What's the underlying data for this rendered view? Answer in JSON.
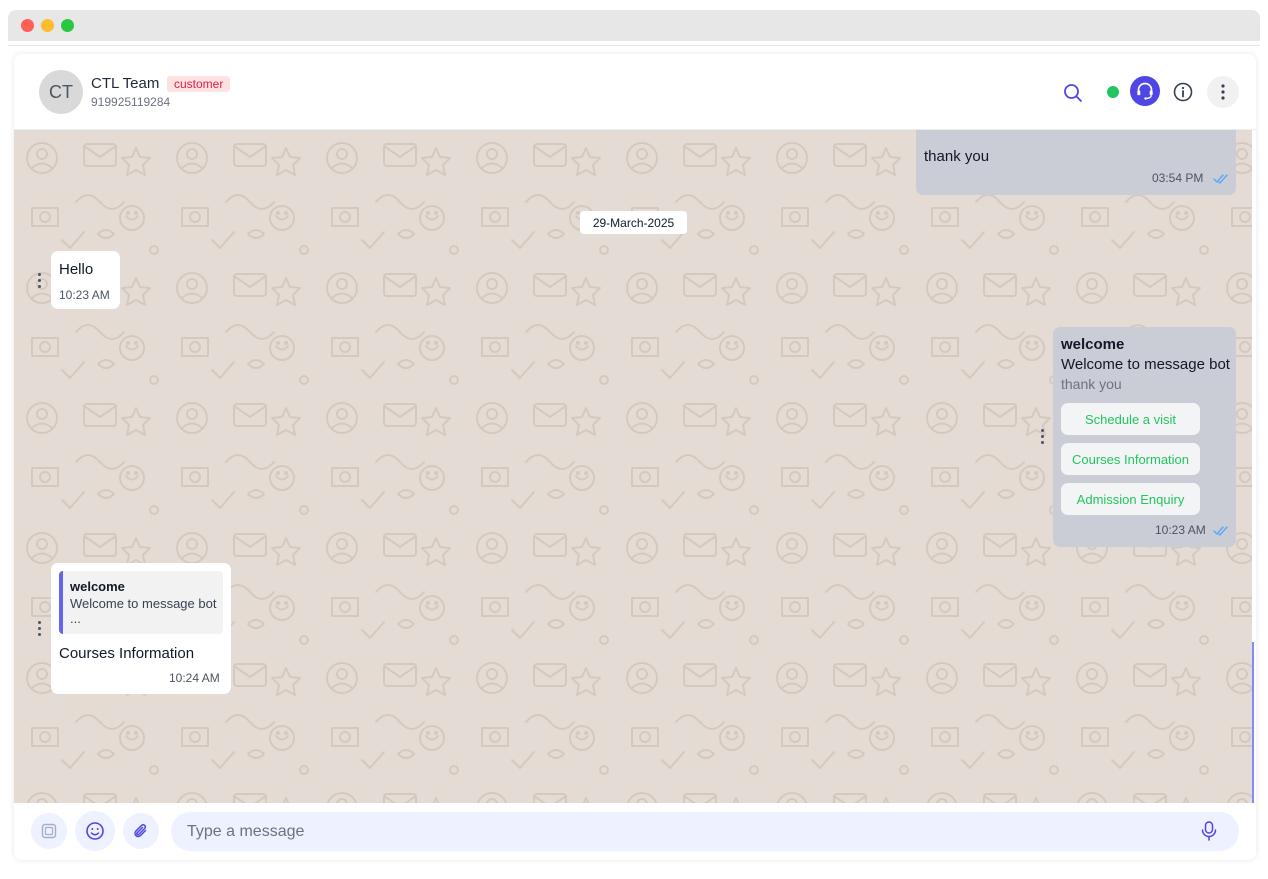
{
  "contact": {
    "initials": "CT",
    "name": "CTL Team",
    "tag": "customer",
    "phone": "919925119284"
  },
  "header_icons": [
    "search-icon",
    "online-status",
    "agent-support-icon",
    "info-icon",
    "more-vertical-icon"
  ],
  "colors": {
    "chat_background": "#e4dcd4",
    "outgoing_bubble": "#cacdd5",
    "incoming_bubble": "#ffffff",
    "online": "#22c55e",
    "accent": "#4f46e5",
    "tag_background": "#fde2e2",
    "tag_text": "#e11d48",
    "template_button_text": "#22c55e"
  },
  "messages": [
    {
      "direction": "out",
      "text": "thank you",
      "time": "03:54 PM",
      "status": "read"
    },
    {
      "type": "date",
      "text": "29-March-2025"
    },
    {
      "direction": "in",
      "text": "Hello",
      "time": "10:23 AM"
    },
    {
      "direction": "out",
      "type": "template",
      "title": "welcome",
      "body": "Welcome to message bot",
      "footer": "thank you",
      "buttons": [
        "Schedule a visit",
        "Courses Information",
        "Admission Enquiry"
      ],
      "time": "10:23 AM",
      "status": "read"
    },
    {
      "direction": "in",
      "type": "reply",
      "quote_title": "welcome",
      "quote_text": "Welcome to message bot",
      "quote_more": "...",
      "text": "Courses Information",
      "time": "10:24 AM"
    }
  ],
  "composer": {
    "placeholder": "Type a message",
    "buttons": [
      "template-icon",
      "emoji-icon",
      "attachment-icon",
      "mic-icon"
    ]
  }
}
